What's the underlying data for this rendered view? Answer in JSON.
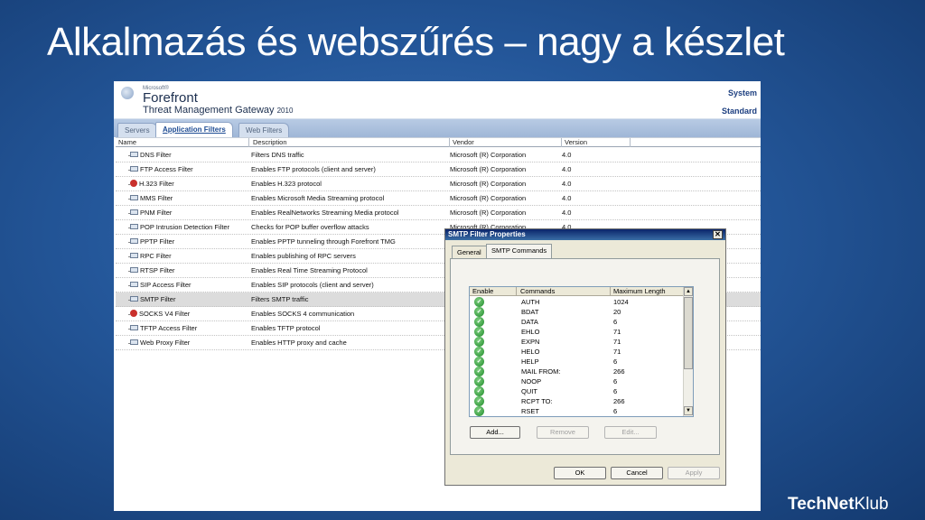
{
  "slide": {
    "title": "Alkalmazás és webszűrés – nagy a készlet",
    "brand_bold": "TechNet",
    "brand_light": "Klub"
  },
  "app": {
    "logo_ms": "Microsoft®",
    "logo_name": "Forefront",
    "product": "Threat Management Gateway",
    "year": "2010",
    "header_right_top": "System",
    "header_right_bottom": "Standard"
  },
  "tabs": [
    {
      "label": "Servers",
      "active": false
    },
    {
      "label": "Application Filters",
      "active": true
    },
    {
      "label": "Web Filters",
      "active": false
    }
  ],
  "grid": {
    "columns": [
      "Name",
      "Description",
      "Vendor",
      "Version"
    ],
    "rows": [
      {
        "name": "DNS Filter",
        "desc": "Filters DNS traffic",
        "vendor": "Microsoft (R) Corporation",
        "version": "4.0",
        "icon": "filter-icon"
      },
      {
        "name": "FTP Access Filter",
        "desc": "Enables FTP protocols (client and server)",
        "vendor": "Microsoft (R) Corporation",
        "version": "4.0",
        "icon": "filter-icon"
      },
      {
        "name": "H.323 Filter",
        "desc": "Enables H.323 protocol",
        "vendor": "Microsoft (R) Corporation",
        "version": "4.0",
        "icon": "alert-filter-icon"
      },
      {
        "name": "MMS Filter",
        "desc": "Enables Microsoft Media Streaming protocol",
        "vendor": "Microsoft (R) Corporation",
        "version": "4.0",
        "icon": "filter-icon"
      },
      {
        "name": "PNM Filter",
        "desc": "Enables RealNetworks Streaming Media protocol",
        "vendor": "Microsoft (R) Corporation",
        "version": "4.0",
        "icon": "filter-icon"
      },
      {
        "name": "POP Intrusion Detection Filter",
        "desc": "Checks for POP buffer overflow attacks",
        "vendor": "Microsoft (R) Corporation",
        "version": "4.0",
        "icon": "filter-icon"
      },
      {
        "name": "PPTP Filter",
        "desc": "Enables PPTP tunneling through Forefront TMG",
        "vendor": "",
        "version": "",
        "icon": "filter-icon"
      },
      {
        "name": "RPC Filter",
        "desc": "Enables publishing of RPC servers",
        "vendor": "",
        "version": "",
        "icon": "filter-icon"
      },
      {
        "name": "RTSP Filter",
        "desc": "Enables Real Time Streaming Protocol",
        "vendor": "",
        "version": "",
        "icon": "filter-icon"
      },
      {
        "name": "SIP Access Filter",
        "desc": "Enables SIP protocols (client and server)",
        "vendor": "",
        "version": "",
        "icon": "filter-icon"
      },
      {
        "name": "SMTP Filter",
        "desc": "Filters SMTP traffic",
        "vendor": "",
        "version": "",
        "icon": "filter-icon",
        "selected": true
      },
      {
        "name": "SOCKS V4 Filter",
        "desc": "Enables SOCKS 4 communication",
        "vendor": "",
        "version": "",
        "icon": "alert-filter-icon"
      },
      {
        "name": "TFTP Access Filter",
        "desc": "Enables TFTP protocol",
        "vendor": "",
        "version": "",
        "icon": "filter-icon"
      },
      {
        "name": "Web Proxy Filter",
        "desc": "Enables HTTP proxy and cache",
        "vendor": "",
        "version": "",
        "icon": "filter-icon"
      }
    ]
  },
  "dialog": {
    "title": "SMTP Filter Properties",
    "tabs": [
      "General",
      "SMTP Commands"
    ],
    "list_columns": [
      "Enable",
      "Commands",
      "Maximum Length"
    ],
    "commands": [
      {
        "command": "AUTH",
        "max_length": "1024"
      },
      {
        "command": "BDAT",
        "max_length": "20"
      },
      {
        "command": "DATA",
        "max_length": "6"
      },
      {
        "command": "EHLO",
        "max_length": "71"
      },
      {
        "command": "EXPN",
        "max_length": "71"
      },
      {
        "command": "HELO",
        "max_length": "71"
      },
      {
        "command": "HELP",
        "max_length": "6"
      },
      {
        "command": "MAIL FROM:",
        "max_length": "266"
      },
      {
        "command": "NOOP",
        "max_length": "6"
      },
      {
        "command": "QUIT",
        "max_length": "6"
      },
      {
        "command": "RCPT TO:",
        "max_length": "266"
      },
      {
        "command": "RSET",
        "max_length": "6"
      }
    ],
    "add_label": "Add...",
    "remove_label": "Remove",
    "edit_label": "Edit...",
    "ok_label": "OK",
    "cancel_label": "Cancel",
    "apply_label": "Apply"
  },
  "colors": {
    "slide_background": "#24579a",
    "dialog_title_bar": "#0a246a",
    "enabled_check": "#1f8a2b"
  }
}
